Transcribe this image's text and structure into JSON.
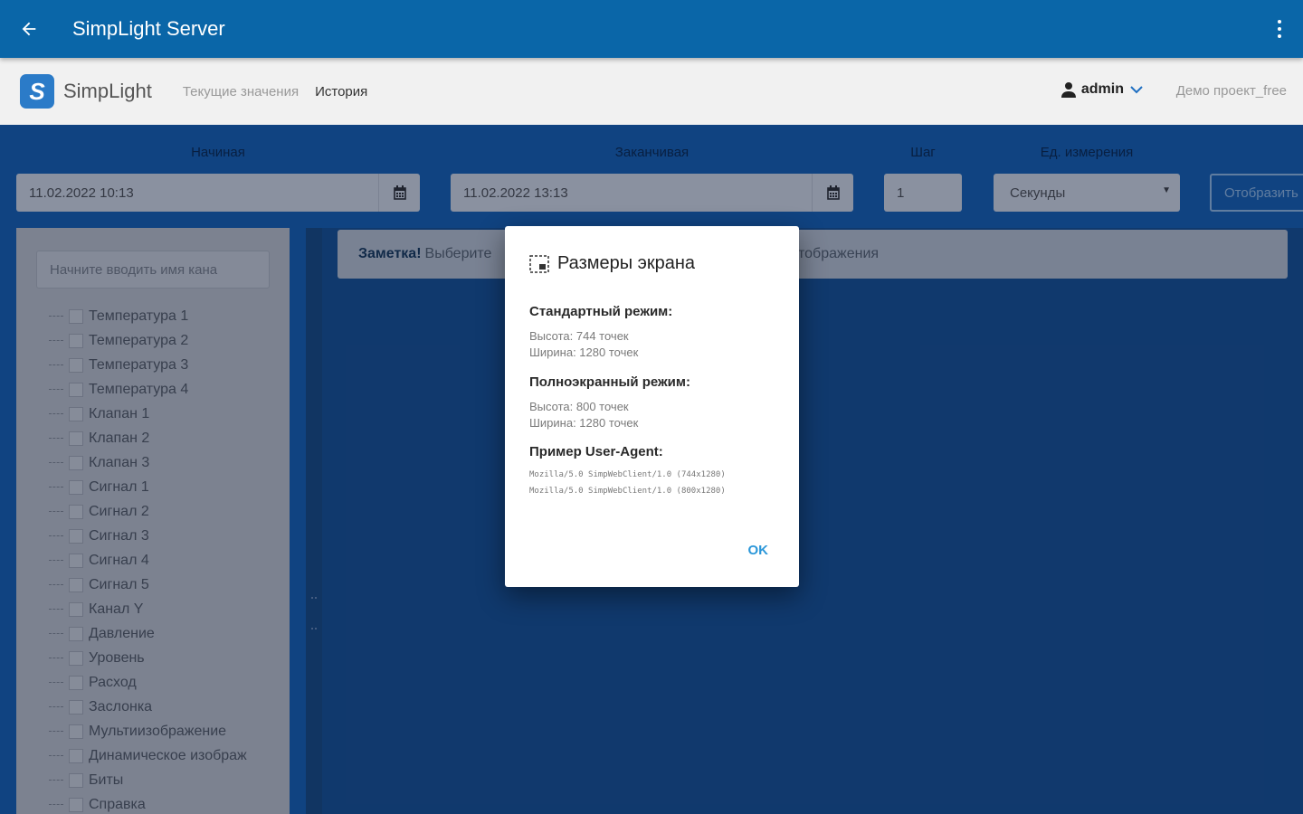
{
  "appbar": {
    "title": "SimpLight Server",
    "back_icon": "arrow-back-icon",
    "menu_icon": "more-vert-icon"
  },
  "header": {
    "brand": "SimpLight",
    "nav": [
      {
        "label": "Текущие значения",
        "active": false
      },
      {
        "label": "История",
        "active": true
      }
    ],
    "user": "admin",
    "project": "Демо проект_free"
  },
  "filters": {
    "start": {
      "label": "Начиная",
      "value": "11.02.2022 10:13"
    },
    "end": {
      "label": "Заканчивая",
      "value": "11.02.2022 13:13"
    },
    "step": {
      "label": "Шаг",
      "value": "1"
    },
    "unit": {
      "label": "Ед. измерения",
      "value": "Секунды"
    },
    "show_button": "Отобразить"
  },
  "sidebar": {
    "search_placeholder": "Начните вводить имя кана",
    "channels": [
      "Температура 1",
      "Температура 2",
      "Температура 3",
      "Температура 4",
      "Клапан 1",
      "Клапан 2",
      "Клапан 3",
      "Сигнал 1",
      "Сигнал 2",
      "Сигнал 3",
      "Сигнал 4",
      "Сигнал 5",
      "Канал Y",
      "Давление",
      "Уровень",
      "Расход",
      "Заслонка",
      "Мультиизображение",
      "Динамическое изображ",
      "Биты",
      "Справка"
    ]
  },
  "alert": {
    "strong": "Заметка!",
    "text": "Выберите",
    "text_tail": "отображения"
  },
  "modal": {
    "title": "Размеры экрана",
    "standard": {
      "heading": "Стандартный режим:",
      "height": "Высота: 744 точек",
      "width": "Ширина: 1280 точек"
    },
    "fullscreen": {
      "heading": "Полноэкранный режим:",
      "height": "Высота: 800 точек",
      "width": "Ширина: 1280 точек"
    },
    "useragent": {
      "heading": "Пример User-Agent:",
      "line1": "Mozilla/5.0 SimpWebClient/1.0 (744x1280)",
      "line2": "Mozilla/5.0 SimpWebClient/1.0 (800x1280)"
    },
    "ok": "OK"
  },
  "colors": {
    "appbar": "#0a66a8",
    "background": "#1a66b8",
    "accent": "#2b97d9"
  }
}
